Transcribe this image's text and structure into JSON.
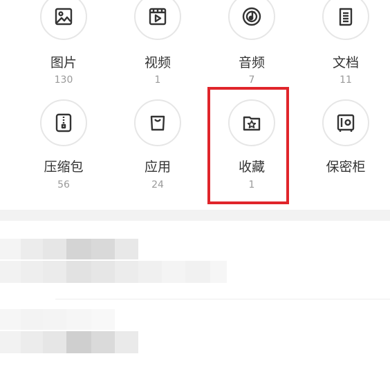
{
  "categories": [
    {
      "label": "图片",
      "count": "130",
      "icon": "image-icon"
    },
    {
      "label": "视频",
      "count": "1",
      "icon": "video-icon"
    },
    {
      "label": "音频",
      "count": "7",
      "icon": "music-disc-icon"
    },
    {
      "label": "文档",
      "count": "11",
      "icon": "document-icon"
    },
    {
      "label": "压缩包",
      "count": "56",
      "icon": "zip-icon"
    },
    {
      "label": "应用",
      "count": "24",
      "icon": "app-bag-icon"
    },
    {
      "label": "收藏",
      "count": "1",
      "icon": "star-folder-icon"
    },
    {
      "label": "保密柜",
      "count": "",
      "icon": "safe-icon"
    }
  ],
  "colors": {
    "highlight": "#e0252b",
    "icon": "#333333",
    "circle_border": "#e6e6e6",
    "count_text": "#999999",
    "band": "#f2f2f2"
  }
}
